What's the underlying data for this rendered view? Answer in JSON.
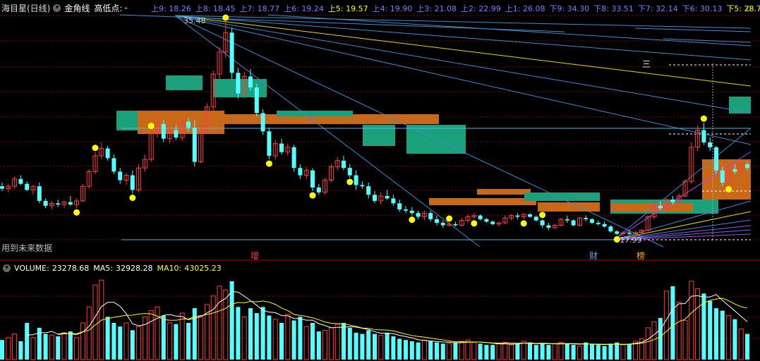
{
  "header": {
    "title": "海目星(日线)",
    "indicator": "金角线",
    "highlow_label": "高低点:",
    "highlow_value": "-",
    "levels": [
      {
        "label": "上9:",
        "value": "18.26",
        "color": "#7d7dff"
      },
      {
        "label": "上8:",
        "value": "18.45",
        "color": "#7d7dff"
      },
      {
        "label": "上7:",
        "value": "18.77",
        "color": "#7d7dff"
      },
      {
        "label": "上6:",
        "value": "19.24",
        "color": "#7d7dff"
      },
      {
        "label": "上5:",
        "value": "19.57",
        "color": "#ffff00"
      },
      {
        "label": "上4:",
        "value": "19.90",
        "color": "#7d7dff"
      },
      {
        "label": "上3:",
        "value": "21.08",
        "color": "#7d7dff"
      },
      {
        "label": "上2:",
        "value": "22.99",
        "color": "#7d7dff"
      },
      {
        "label": "上1:",
        "value": "26.08",
        "color": "#7d7dff"
      },
      {
        "label": "下9:",
        "value": "34.30",
        "color": "#7d7dff"
      },
      {
        "label": "下8:",
        "value": "33.51",
        "color": "#7d7dff"
      },
      {
        "label": "下7:",
        "value": "32.14",
        "color": "#7d7dff"
      },
      {
        "label": "下6:",
        "value": "30.13",
        "color": "#7d7dff"
      },
      {
        "label": "下5:",
        "value": "28.7",
        "color": "#ffff00"
      }
    ],
    "colors": {
      "title": "#dddddd",
      "indicator": "#ffffff",
      "highlow": "#ffffff"
    }
  },
  "annotations": {
    "high_price": "35.48",
    "low_price": "17.99",
    "future_note": "用到未来数据",
    "mark_san": "三",
    "event_zeng": "增",
    "event_cai": "财",
    "event_bang": "榜"
  },
  "volume_header": {
    "label": "VOLUME:",
    "value": "23278.68",
    "ma5_label": "MA5:",
    "ma5_value": "32928.28",
    "ma10_label": "MA10:",
    "ma10_value": "43025.23",
    "colors": {
      "volume": "#ffffff",
      "ma5": "#ffffff",
      "ma10": "#ffff00"
    }
  },
  "colors": {
    "background": "#000000",
    "up": "#ff3c3c",
    "down": "#54ffff",
    "ma5": "#ffffff",
    "ma10": "#ffff00",
    "box_green": "#1aa07a",
    "box_orange": "#c8691a",
    "fan_blue": "#3c8cd2",
    "fan_yellow": "#e8d800",
    "fan_purple": "#b040ff",
    "grid": "#8b0000",
    "dot": "#ffff00"
  },
  "chart_data": {
    "type": "candlestick",
    "ylim": [
      17.5,
      36.0
    ],
    "candles": [
      [
        22.0,
        22.3,
        21.6,
        21.8
      ],
      [
        21.8,
        22.2,
        21.5,
        22.0
      ],
      [
        22.0,
        22.8,
        21.8,
        22.6
      ],
      [
        22.6,
        22.9,
        22.1,
        22.2
      ],
      [
        22.2,
        22.4,
        21.6,
        21.7
      ],
      [
        21.7,
        22.1,
        21.3,
        22.0
      ],
      [
        22.0,
        22.3,
        20.6,
        20.8
      ],
      [
        20.8,
        21.0,
        20.2,
        20.4
      ],
      [
        20.4,
        20.8,
        20.1,
        20.6
      ],
      [
        20.6,
        20.9,
        20.3,
        20.5
      ],
      [
        20.5,
        20.8,
        20.2,
        20.7
      ],
      [
        20.7,
        21.2,
        20.4,
        20.5
      ],
      [
        20.5,
        21.0,
        20.2,
        20.8
      ],
      [
        20.8,
        22.2,
        20.7,
        22.0
      ],
      [
        22.0,
        23.4,
        21.8,
        23.2
      ],
      [
        23.2,
        24.8,
        23.0,
        24.5
      ],
      [
        24.5,
        25.6,
        24.2,
        25.1
      ],
      [
        25.1,
        25.3,
        24.1,
        24.3
      ],
      [
        24.3,
        24.6,
        23.0,
        23.2
      ],
      [
        23.2,
        23.5,
        22.2,
        22.5
      ],
      [
        22.5,
        23.1,
        22.1,
        22.9
      ],
      [
        22.9,
        23.3,
        21.4,
        21.7
      ],
      [
        21.7,
        23.8,
        21.5,
        23.5
      ],
      [
        23.5,
        24.6,
        23.2,
        24.2
      ],
      [
        24.2,
        26.6,
        24.0,
        26.3
      ],
      [
        26.3,
        27.5,
        26.0,
        27.1
      ],
      [
        27.1,
        27.4,
        25.6,
        25.9
      ],
      [
        25.9,
        26.8,
        25.5,
        26.6
      ],
      [
        26.6,
        27.0,
        25.8,
        26.0
      ],
      [
        26.0,
        27.6,
        25.7,
        27.3
      ],
      [
        27.3,
        27.6,
        26.5,
        26.8
      ],
      [
        26.8,
        27.4,
        23.6,
        24.0
      ],
      [
        24.0,
        26.8,
        23.9,
        26.6
      ],
      [
        26.6,
        28.8,
        26.4,
        28.5
      ],
      [
        28.5,
        31.5,
        28.2,
        31.2
      ],
      [
        31.2,
        33.4,
        30.8,
        33.0
      ],
      [
        33.0,
        35.48,
        32.5,
        34.6
      ],
      [
        34.6,
        35.0,
        30.8,
        31.3
      ],
      [
        31.3,
        31.7,
        29.2,
        29.6
      ],
      [
        29.6,
        31.4,
        29.2,
        31.0
      ],
      [
        31.0,
        31.6,
        29.8,
        30.1
      ],
      [
        30.1,
        30.4,
        27.7,
        28.0
      ],
      [
        28.0,
        28.3,
        26.2,
        26.5
      ],
      [
        26.5,
        26.8,
        24.2,
        24.5
      ],
      [
        24.5,
        25.8,
        24.2,
        25.5
      ],
      [
        25.5,
        25.9,
        24.6,
        24.8
      ],
      [
        24.8,
        25.5,
        24.5,
        25.2
      ],
      [
        25.2,
        25.4,
        23.2,
        23.5
      ],
      [
        23.5,
        23.8,
        22.6,
        22.9
      ],
      [
        22.9,
        23.6,
        22.6,
        23.3
      ],
      [
        23.3,
        23.5,
        21.6,
        21.9
      ],
      [
        21.9,
        22.2,
        21.3,
        21.5
      ],
      [
        21.5,
        22.7,
        21.3,
        22.5
      ],
      [
        22.5,
        23.8,
        22.3,
        23.6
      ],
      [
        23.6,
        24.4,
        23.3,
        24.1
      ],
      [
        24.1,
        24.5,
        23.3,
        23.5
      ],
      [
        23.5,
        23.8,
        22.7,
        22.9
      ],
      [
        22.9,
        23.3,
        21.7,
        22.1
      ],
      [
        22.1,
        22.4,
        21.8,
        22.0
      ],
      [
        22.0,
        22.3,
        21.0,
        21.3
      ],
      [
        21.3,
        21.6,
        20.6,
        20.8
      ],
      [
        20.8,
        21.5,
        20.5,
        21.2
      ],
      [
        21.2,
        21.7,
        20.9,
        21.0
      ],
      [
        21.0,
        21.3,
        20.4,
        20.6
      ],
      [
        20.6,
        20.9,
        19.9,
        20.1
      ],
      [
        20.1,
        20.4,
        19.8,
        20.0
      ],
      [
        20.0,
        20.3,
        19.6,
        19.8
      ],
      [
        19.8,
        20.0,
        19.3,
        19.5
      ],
      [
        19.5,
        20.0,
        19.2,
        19.8
      ],
      [
        19.8,
        20.0,
        19.1,
        19.3
      ],
      [
        19.3,
        19.6,
        18.8,
        19.0
      ],
      [
        19.0,
        19.2,
        18.6,
        18.8
      ],
      [
        18.8,
        19.0,
        18.7,
        18.9
      ],
      [
        18.9,
        19.1,
        18.7,
        18.8
      ],
      [
        18.8,
        19.4,
        18.7,
        19.2
      ],
      [
        19.2,
        19.7,
        19.0,
        19.5
      ],
      [
        19.5,
        19.8,
        19.3,
        19.6
      ],
      [
        19.6,
        19.7,
        19.2,
        19.3
      ],
      [
        19.3,
        19.4,
        19.0,
        19.1
      ],
      [
        19.1,
        19.2,
        18.8,
        18.9
      ],
      [
        18.9,
        19.1,
        18.7,
        19.0
      ],
      [
        19.0,
        19.6,
        18.9,
        19.4
      ],
      [
        19.4,
        19.7,
        19.2,
        19.6
      ],
      [
        19.6,
        19.8,
        19.3,
        19.5
      ],
      [
        19.5,
        19.8,
        19.3,
        19.7
      ],
      [
        19.7,
        19.8,
        19.4,
        19.5
      ],
      [
        19.5,
        19.6,
        19.1,
        19.2
      ],
      [
        19.2,
        19.3,
        18.6,
        18.8
      ],
      [
        18.8,
        19.0,
        18.4,
        18.6
      ],
      [
        18.6,
        18.9,
        18.5,
        18.8
      ],
      [
        18.8,
        19.4,
        18.7,
        19.3
      ],
      [
        19.3,
        19.6,
        19.0,
        19.2
      ],
      [
        19.2,
        19.3,
        18.7,
        18.8
      ],
      [
        18.8,
        19.5,
        18.7,
        19.4
      ],
      [
        19.4,
        19.6,
        19.1,
        19.3
      ],
      [
        19.3,
        19.4,
        18.9,
        19.0
      ],
      [
        19.0,
        19.2,
        18.8,
        18.9
      ],
      [
        18.9,
        19.1,
        18.6,
        18.7
      ],
      [
        18.7,
        18.8,
        18.2,
        18.3
      ],
      [
        18.3,
        18.4,
        17.99,
        18.1
      ],
      [
        18.1,
        18.3,
        17.99,
        18.2
      ],
      [
        18.2,
        18.4,
        18.0,
        18.1
      ],
      [
        18.1,
        18.3,
        17.99,
        18.2
      ],
      [
        18.2,
        18.5,
        18.1,
        18.4
      ],
      [
        18.4,
        19.6,
        18.3,
        19.5
      ],
      [
        19.5,
        20.6,
        19.3,
        20.4
      ],
      [
        20.4,
        20.8,
        20.0,
        20.2
      ],
      [
        20.2,
        21.0,
        20.1,
        20.9
      ],
      [
        20.9,
        21.2,
        20.5,
        20.7
      ],
      [
        20.7,
        21.4,
        20.6,
        21.2
      ],
      [
        21.2,
        22.6,
        21.1,
        22.4
      ],
      [
        22.4,
        25.6,
        22.2,
        25.2
      ],
      [
        25.2,
        27.0,
        24.9,
        26.6
      ],
      [
        26.6,
        27.2,
        25.4,
        25.6
      ],
      [
        25.6,
        26.0,
        24.9,
        25.2
      ],
      [
        25.2,
        25.3,
        23.0,
        23.3
      ],
      [
        23.3,
        23.6,
        22.0,
        22.3
      ],
      [
        22.3,
        23.6,
        22.1,
        23.4
      ],
      [
        23.4,
        23.8,
        23.0,
        23.2
      ],
      [
        23.2,
        24.0,
        23.0,
        23.8
      ],
      [
        23.8,
        24.0,
        23.3,
        23.5
      ]
    ],
    "volume": [
      160,
      180,
      210,
      150,
      300,
      180,
      260,
      210,
      200,
      190,
      220,
      230,
      180,
      300,
      430,
      610,
      650,
      350,
      300,
      270,
      300,
      240,
      270,
      350,
      400,
      430,
      360,
      300,
      290,
      380,
      300,
      420,
      360,
      450,
      520,
      600,
      570,
      640,
      430,
      350,
      420,
      380,
      430,
      360,
      330,
      300,
      370,
      320,
      350,
      270,
      300,
      230,
      240,
      260,
      290,
      300,
      260,
      220,
      210,
      240,
      210,
      200,
      220,
      190,
      170,
      160,
      150,
      140,
      160,
      150,
      140,
      130,
      130,
      140,
      150,
      160,
      140,
      130,
      120,
      120,
      130,
      140,
      120,
      130,
      150,
      140,
      120,
      130,
      120,
      130,
      140,
      130,
      120,
      110,
      140,
      130,
      120,
      110,
      130,
      140,
      120,
      130,
      150,
      170,
      260,
      310,
      340,
      560,
      600,
      470,
      320,
      640,
      580,
      540,
      480,
      420,
      400,
      360,
      330,
      250,
      210
    ],
    "volume_ylim": [
      0,
      680
    ]
  }
}
